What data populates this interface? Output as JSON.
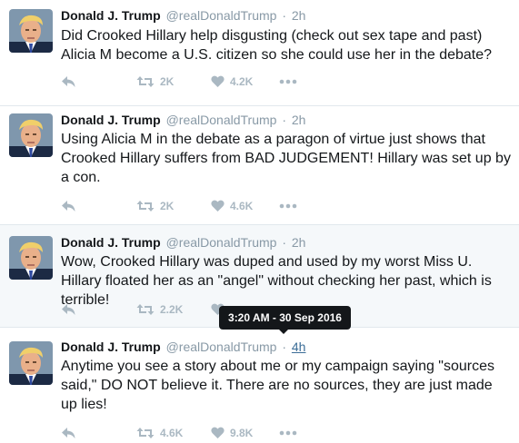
{
  "tweets": [
    {
      "fullname": "Donald J. Trump",
      "username": "@realDonaldTrump",
      "time": "2h",
      "text": "Did Crooked Hillary help disgusting (check out sex tape and past) Alicia M become a U.S. citizen so she could use her in the debate?",
      "retweets": "2K",
      "likes": "4.2K"
    },
    {
      "fullname": "Donald J. Trump",
      "username": "@realDonaldTrump",
      "time": "2h",
      "text": "Using Alicia M in the debate as a paragon of virtue just shows that Crooked Hillary suffers from BAD JUDGEMENT! Hillary was set up by a con.",
      "retweets": "2K",
      "likes": "4.6K"
    },
    {
      "fullname": "Donald J. Trump",
      "username": "@realDonaldTrump",
      "time": "2h",
      "text": "Wow, Crooked Hillary was duped and used by my worst Miss U. Hillary floated her as an \"angel\" without checking her past, which is terrible!",
      "retweets": "2.2K",
      "likes": ""
    },
    {
      "fullname": "Donald J. Trump",
      "username": "@realDonaldTrump",
      "time": "4h",
      "text": "Anytime you see a story about me or my campaign saying \"sources said,\" DO NOT believe it. There are no sources, they are just made up lies!",
      "retweets": "4.6K",
      "likes": "9.8K"
    }
  ],
  "separator": "·",
  "tooltip": "3:20 AM - 30 Sep 2016",
  "colors": {
    "text": "#14171a",
    "secondary": "#8899a6",
    "icon": "#aab8c2",
    "hover_bg": "#f5f8fa",
    "border": "#e1e8ed",
    "link": "#3b6d97"
  }
}
